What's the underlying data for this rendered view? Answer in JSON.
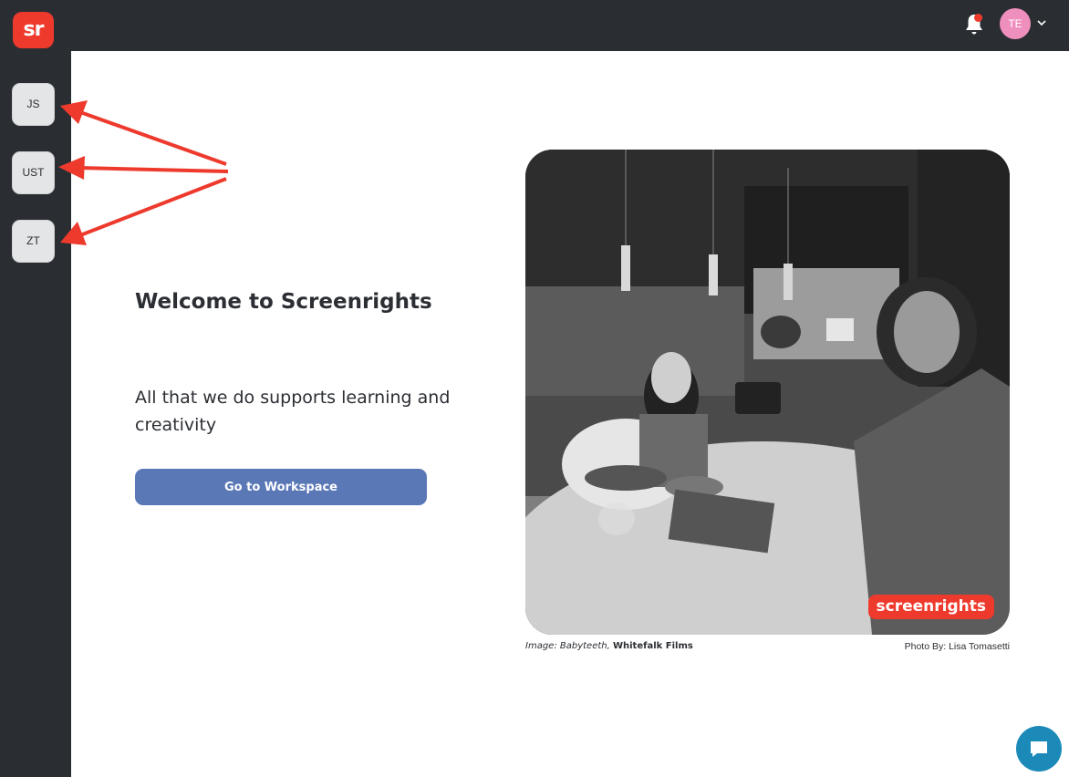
{
  "app": {
    "logo_text": "sr",
    "brand_color": "#ee3a2d",
    "sidebar_color": "#2a2e33"
  },
  "sidebar": {
    "workspaces": [
      {
        "label": "JS"
      },
      {
        "label": "UST"
      },
      {
        "label": "ZT"
      }
    ]
  },
  "header": {
    "notification_icon": "bell-icon",
    "has_unread": true,
    "user_initials": "TE",
    "menu_icon": "chevron-down-icon"
  },
  "main": {
    "title": "Welcome to Screenrights",
    "subtitle": "All that we do supports learning and creativity",
    "cta_label": "Go to Workspace",
    "cta_color": "#5a77b6",
    "image_badge": "screenrights",
    "caption_prefix": "Image:",
    "caption_title": "Babyteeth,",
    "caption_company": "Whitefalk Films",
    "photo_credit": "Photo By: Lisa Tomasetti"
  },
  "chat": {
    "icon": "chat-bubble-icon",
    "color": "#1b8ab8"
  },
  "annotations": {
    "arrow_color": "#ee3a2d"
  }
}
